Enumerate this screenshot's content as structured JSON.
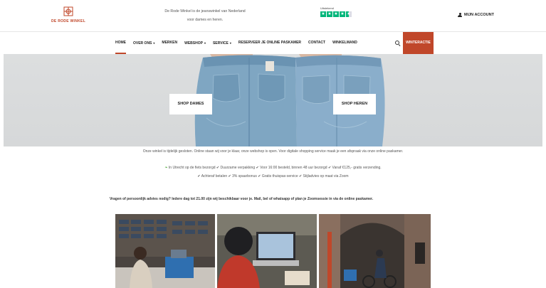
{
  "header": {
    "logo_text": "DE RODE WINKEL",
    "tagline_line1": "De Rode Winkel is de jeanswinkel van Nederland",
    "tagline_line2": "voor dames en heren.",
    "trustpilot_title": "Uitstekend",
    "trustpilot_stars": 4.5,
    "account_label": "MIJN ACCOUNT"
  },
  "nav": {
    "items": [
      {
        "label": "HOME",
        "active": true,
        "dropdown": false
      },
      {
        "label": "OVER ONS",
        "active": false,
        "dropdown": true
      },
      {
        "label": "MERKEN",
        "active": false,
        "dropdown": false
      },
      {
        "label": "WEBSHOP",
        "active": false,
        "dropdown": true
      },
      {
        "label": "SERVICE",
        "active": false,
        "dropdown": true
      },
      {
        "label": "RESERVEER JE ONLINE PASKAMER",
        "active": false,
        "dropdown": false
      },
      {
        "label": "CONTACT",
        "active": false,
        "dropdown": false
      },
      {
        "label": "WINKELMAND",
        "active": false,
        "dropdown": false
      }
    ],
    "cta_label": "WINTERACTIE",
    "accent_color": "#c0472a"
  },
  "hero": {
    "shop_women": "SHOP DAMES",
    "shop_men": "SHOP HEREN"
  },
  "info": {
    "line1": "Onze winkel is tijdelijk gesloten. Online staan wij voor je klaar, onze webshop is open. Voor digitale shopping service maak je een afspraak via onze online paskamer.",
    "line2": "In Utrecht op de fiets bezorgd ✔ Duurzame verpakking ✔ Voor 16:00 besteld, binnen 48 uur bezorgd ✔ Vanaf €125,- gratis verzending.",
    "line3": "✔ Achteraf betalen ✔ 3% spaarbonus ✔ Gratis thuispas-service ✔ Stijladvies op maat via Zoom",
    "question": "Vragen of persoonlijk advies nodig? Iedere dag tot 21.00 zijn wij beschikbaar voor je. Mail, bel of whatsapp of plan je Zoomsessie in via de online paskamer."
  }
}
